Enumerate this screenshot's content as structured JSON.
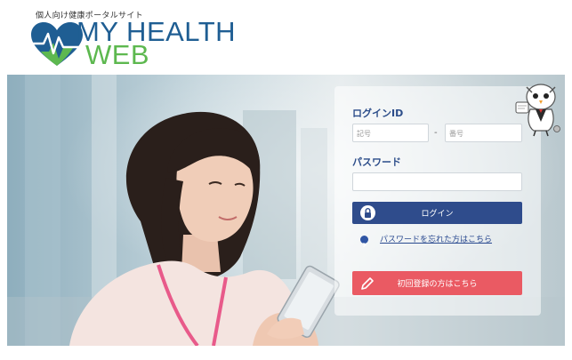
{
  "header": {
    "tagline": "個人向け健康ポータルサイト",
    "logo_line1": "MY HEALTH",
    "logo_line2": "WEB"
  },
  "login": {
    "id_label": "ログインID",
    "symbol_placeholder": "記号",
    "dash": "-",
    "number_placeholder": "番号",
    "password_label": "パスワード",
    "login_button": "ログイン",
    "forgot_link": "パスワードを忘れた方はこちら",
    "register_button": "初回登録の方はこちら"
  },
  "icons": {
    "logo": "heart-pulse-logo-icon",
    "lock": "lock-icon",
    "arrow": "chevron-right-icon",
    "pencil": "pencil-icon",
    "mascot": "owl-mascot-icon"
  },
  "colors": {
    "brand_blue": "#1f5e93",
    "brand_green": "#5db84f",
    "login_button": "#2f4c8c",
    "register_button": "#ea5a63"
  }
}
